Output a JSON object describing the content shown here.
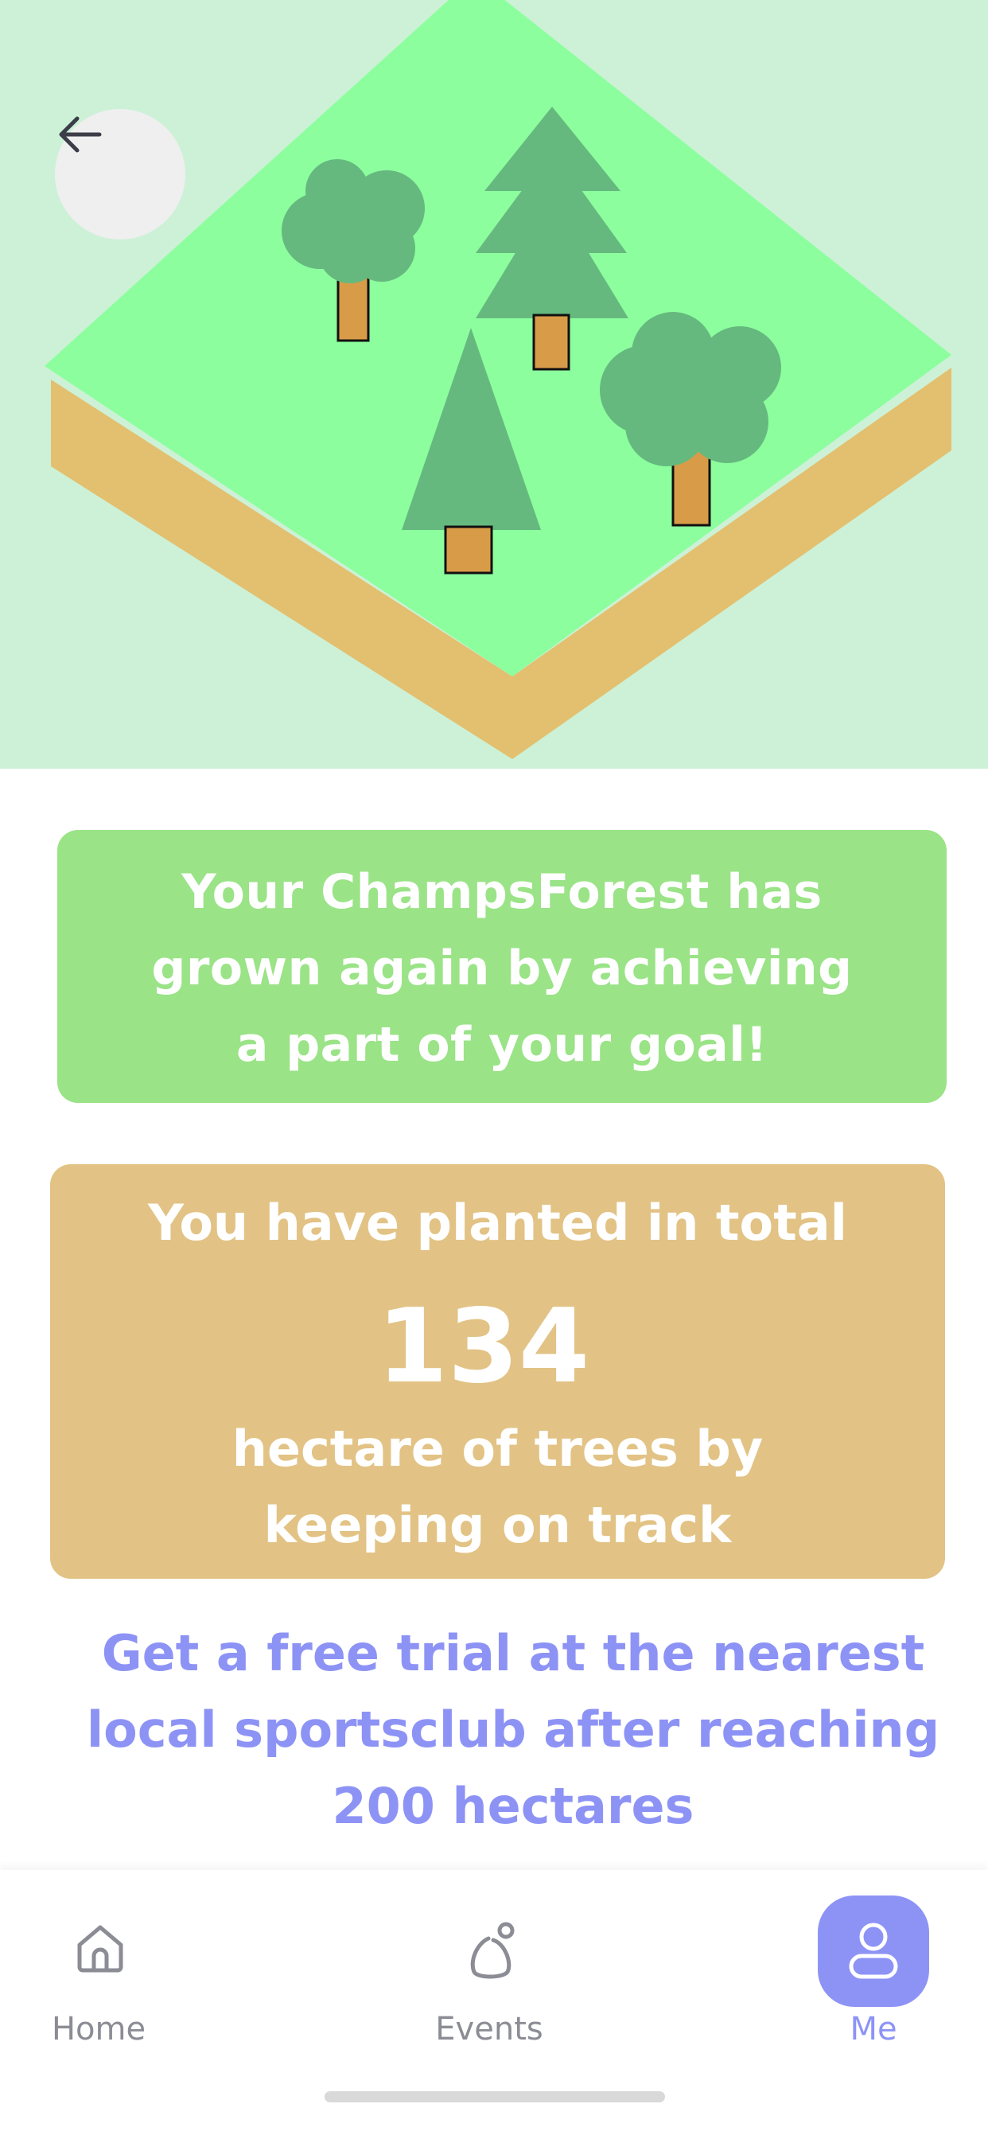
{
  "hero": {
    "back_icon": "arrow-left-icon"
  },
  "growth_card": {
    "line1": "Your ChampsForest has",
    "line2": "grown again by achieving",
    "line3": "a part of your goal!"
  },
  "total_card": {
    "heading": "You have planted in total",
    "value": "134",
    "tail_line1": "hectare of trees by",
    "tail_line2": "keeping on track"
  },
  "promo": {
    "line1": "Get a free trial at the nearest",
    "line2": "local sportsclub after reaching",
    "line3": "200 hectares"
  },
  "tabbar": {
    "tabs": [
      {
        "label": "Home",
        "icon": "home-icon",
        "active": false
      },
      {
        "label": "Events",
        "icon": "events-icon",
        "active": false
      },
      {
        "label": "Me",
        "icon": "user-icon",
        "active": true
      }
    ]
  },
  "colors": {
    "accent": "#8d93f5",
    "green_card": "#9ae387",
    "tan_card": "#e2c385",
    "hero_bg": "#cdf1d7",
    "grass": "#8cfe9e",
    "foliage": "#65b97e",
    "trunk": "#d89c48"
  }
}
